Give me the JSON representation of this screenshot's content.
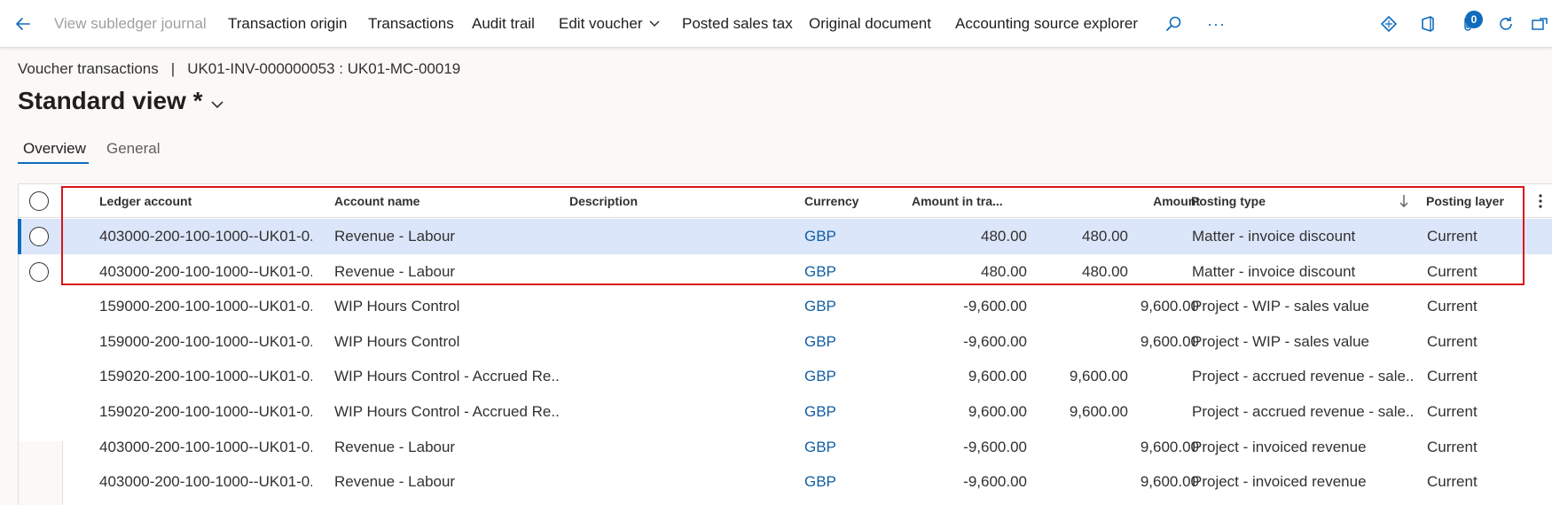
{
  "actionbar": {
    "items": [
      {
        "label": "View subledger journal",
        "disabled": true
      },
      {
        "label": "Transaction origin"
      },
      {
        "label": "Transactions"
      },
      {
        "label": "Audit trail"
      },
      {
        "label": "Edit voucher"
      },
      {
        "label": "Posted sales tax"
      },
      {
        "label": "Original document"
      },
      {
        "label": "Accounting source explorer"
      }
    ],
    "more_label": "···",
    "attachments_count": "0"
  },
  "breadcrumb": {
    "page": "Voucher transactions",
    "separator": "|",
    "record": "UK01-INV-000000053 : UK01-MC-00019"
  },
  "view": {
    "title": "Standard view *"
  },
  "tabs": [
    {
      "label": "Overview",
      "active": true
    },
    {
      "label": "General",
      "active": false
    }
  ],
  "grid": {
    "columns": {
      "ledger_account": "Ledger account",
      "account_name": "Account name",
      "description": "Description",
      "currency": "Currency",
      "amount_in_transaction": "Amount in tra...",
      "amount": "Amount",
      "posting_type": "Posting type",
      "posting_layer": "Posting layer"
    },
    "rows": [
      {
        "ledger_account": "403000-200-100-1000--UK01-0...",
        "account_name": "Revenue - Labour",
        "description": "",
        "currency": "GBP",
        "amount_in_transaction": "480.00",
        "debit": "480.00",
        "credit": "",
        "posting_type": "Matter - invoice discount",
        "posting_layer": "Current"
      },
      {
        "ledger_account": "403000-200-100-1000--UK01-0...",
        "account_name": "Revenue - Labour",
        "description": "",
        "currency": "GBP",
        "amount_in_transaction": "480.00",
        "debit": "480.00",
        "credit": "",
        "posting_type": "Matter - invoice discount",
        "posting_layer": "Current"
      },
      {
        "ledger_account": "159000-200-100-1000--UK01-0...",
        "account_name": "WIP Hours Control",
        "description": "",
        "currency": "GBP",
        "amount_in_transaction": "-9,600.00",
        "debit": "",
        "credit": "9,600.00",
        "posting_type": "Project - WIP - sales value",
        "posting_layer": "Current"
      },
      {
        "ledger_account": "159000-200-100-1000--UK01-0...",
        "account_name": "WIP Hours Control",
        "description": "",
        "currency": "GBP",
        "amount_in_transaction": "-9,600.00",
        "debit": "",
        "credit": "9,600.00",
        "posting_type": "Project - WIP - sales value",
        "posting_layer": "Current"
      },
      {
        "ledger_account": "159020-200-100-1000--UK01-0...",
        "account_name": "WIP Hours Control - Accrued Re...",
        "description": "",
        "currency": "GBP",
        "amount_in_transaction": "9,600.00",
        "debit": "9,600.00",
        "credit": "",
        "posting_type": "Project - accrued revenue - sale...",
        "posting_layer": "Current"
      },
      {
        "ledger_account": "159020-200-100-1000--UK01-0...",
        "account_name": "WIP Hours Control - Accrued Re...",
        "description": "",
        "currency": "GBP",
        "amount_in_transaction": "9,600.00",
        "debit": "9,600.00",
        "credit": "",
        "posting_type": "Project - accrued revenue - sale...",
        "posting_layer": "Current"
      },
      {
        "ledger_account": "403000-200-100-1000--UK01-0...",
        "account_name": "Revenue - Labour",
        "description": "",
        "currency": "GBP",
        "amount_in_transaction": "-9,600.00",
        "debit": "",
        "credit": "9,600.00",
        "posting_type": "Project - invoiced revenue",
        "posting_layer": "Current"
      },
      {
        "ledger_account": "403000-200-100-1000--UK01-0...",
        "account_name": "Revenue - Labour",
        "description": "",
        "currency": "GBP",
        "amount_in_transaction": "-9,600.00",
        "debit": "",
        "credit": "9,600.00",
        "posting_type": "Project - invoiced revenue",
        "posting_layer": "Current"
      }
    ]
  },
  "colors": {
    "accent": "#0f6cbd",
    "selected_row": "#dce6fa",
    "highlight_box": "#d9141b"
  }
}
